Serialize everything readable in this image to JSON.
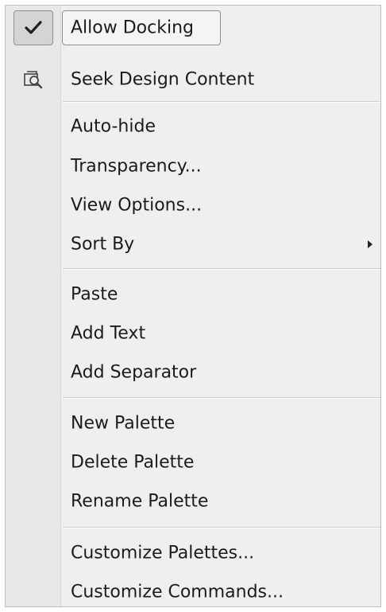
{
  "menu": {
    "allow_docking": {
      "label": "Allow Docking",
      "checked": true,
      "icon": "checkmark-icon"
    },
    "seek_design_content": {
      "label": "Seek Design Content",
      "icon": "seek-design-content-icon"
    },
    "auto_hide": {
      "label": "Auto-hide"
    },
    "transparency": {
      "label": "Transparency..."
    },
    "view_options": {
      "label": "View Options..."
    },
    "sort_by": {
      "label": "Sort By",
      "has_submenu": true,
      "submenu_icon": "submenu-arrow-icon"
    },
    "paste": {
      "label": "Paste"
    },
    "add_text": {
      "label": "Add Text"
    },
    "add_separator": {
      "label": "Add Separator"
    },
    "new_palette": {
      "label": "New Palette"
    },
    "delete_palette": {
      "label": "Delete Palette"
    },
    "rename_palette": {
      "label": "Rename Palette"
    },
    "customize_palettes": {
      "label": "Customize Palettes..."
    },
    "customize_commands": {
      "label": "Customize Commands..."
    }
  }
}
